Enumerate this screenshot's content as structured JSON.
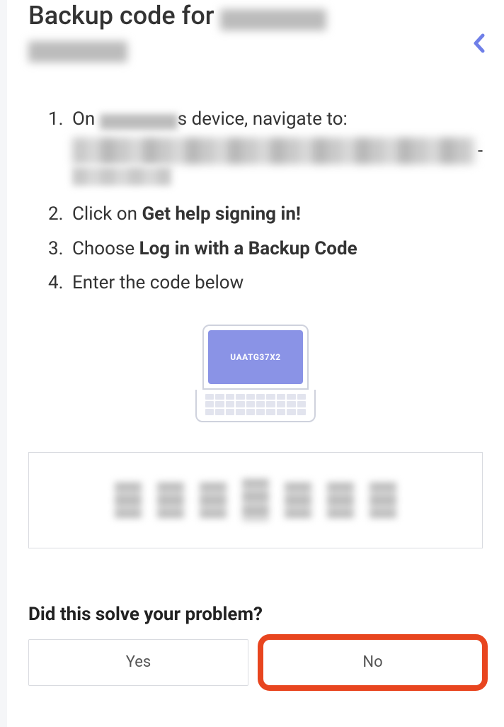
{
  "title_prefix": "Backup code for ",
  "steps": {
    "s1_prefix": "On ",
    "s1_suffix": "s device, navigate to:",
    "s2_prefix": "Click on ",
    "s2_bold": "Get help signing in!",
    "s3_prefix": "Choose ",
    "s3_bold": "Log in with a Backup Code",
    "s4": "Enter the code below"
  },
  "laptop_screen_code": "UAATG37X2",
  "feedback_question": "Did this solve your problem?",
  "buttons": {
    "yes": "Yes",
    "no": "No"
  }
}
